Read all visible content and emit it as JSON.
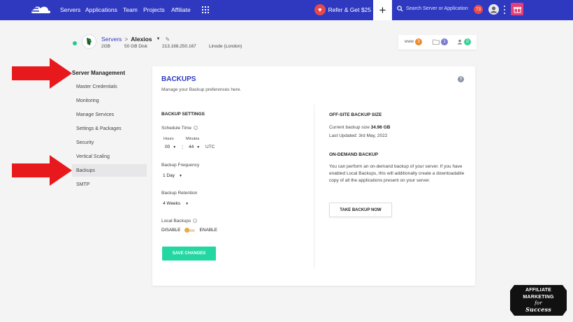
{
  "nav": {
    "links": [
      "Servers",
      "Applications",
      "Team",
      "Projects",
      "Affiliate"
    ],
    "refer_label": "Refer & Get $25",
    "plus_label": "+",
    "search_placeholder": "Search Server or Application",
    "notification_count": "73"
  },
  "server": {
    "breadcrumb_root": "Servers",
    "breadcrumb_sep": ">",
    "name": "Alexios",
    "ram": "2GB",
    "disk": "50 GB Disk",
    "ip": "213.168.250.167",
    "provider": "Linode (London)",
    "stats": {
      "www_label": "www",
      "www_count": "3",
      "folder_count": "1",
      "users_count": "0"
    }
  },
  "sidebar": {
    "title": "Server Management",
    "items": [
      {
        "label": "Master Credentials"
      },
      {
        "label": "Monitoring"
      },
      {
        "label": "Manage Services"
      },
      {
        "label": "Settings & Packages"
      },
      {
        "label": "Security"
      },
      {
        "label": "Vertical Scaling"
      },
      {
        "label": "Backups"
      },
      {
        "label": "SMTP"
      }
    ],
    "active_index": 6
  },
  "backups": {
    "title": "BACKUPS",
    "subtitle": "Manage your Backup preferences here.",
    "help_icon": "?",
    "settings_heading": "BACKUP SETTINGS",
    "schedule_label": "Schedule Time",
    "hours_label": "Hours",
    "minutes_label": "Minutes",
    "hours_value": "00",
    "minutes_value": "44",
    "time_separator": ":",
    "timezone": "UTC",
    "frequency_label": "Backup Frequency",
    "frequency_value": "1 Day",
    "retention_label": "Backup Retention",
    "retention_value": "4 Weeks",
    "local_label": "Local Backups",
    "disable_label": "DISABLE",
    "enable_label": "ENABLE",
    "save_label": "SAVE CHANGES",
    "offsite_heading": "OFF-SITE BACKUP SIZE",
    "current_size_label": "Current backup size",
    "current_size_value": "34.96 GB",
    "last_updated": "Last Updated: 3rd May, 2022",
    "ondemand_heading": "ON-DEMAND BACKUP",
    "ondemand_text": "You can perform an on-demand backup of your server. If you have enabled Local Backups, this will additionally create a downloadable copy of all the applications present on your server.",
    "take_backup_label": "TAKE BACKUP NOW"
  },
  "watermark": {
    "line1": "AFFILIATE",
    "line2": "MARKETING",
    "line3": "for",
    "line4": "Success"
  },
  "colors": {
    "nav_bg": "#2f39bf",
    "accent_green": "#22d7a1",
    "arrow_red": "#e8191c",
    "toggle_orange": "#e9a943"
  }
}
